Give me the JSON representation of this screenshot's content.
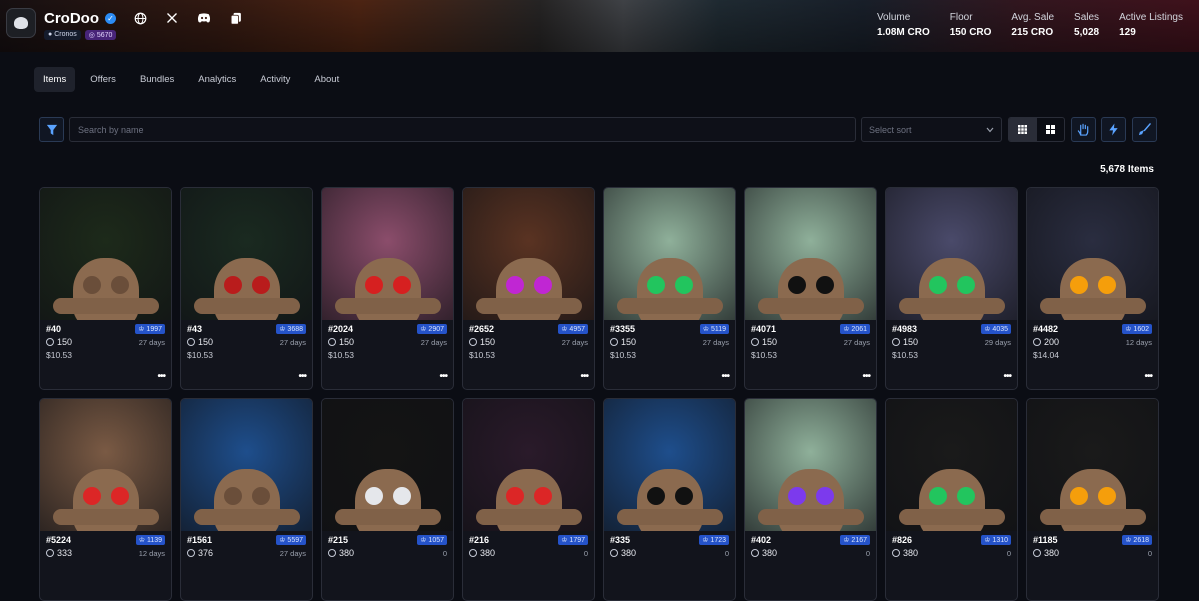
{
  "collection": {
    "name": "CroDoo",
    "chain_chip": "Cronos",
    "id_chip": "5670"
  },
  "stats": [
    {
      "label": "Volume",
      "value": "1.08M CRO"
    },
    {
      "label": "Floor",
      "value": "150 CRO"
    },
    {
      "label": "Avg. Sale",
      "value": "215 CRO"
    },
    {
      "label": "Sales",
      "value": "5,028"
    },
    {
      "label": "Active Listings",
      "value": "129"
    }
  ],
  "tabs": [
    "Items",
    "Offers",
    "Bundles",
    "Analytics",
    "Activity",
    "About"
  ],
  "search": {
    "placeholder": "Search by name",
    "value": ""
  },
  "sort": {
    "placeholder": "Select sort"
  },
  "item_count": "5,678 Items",
  "items": [
    {
      "token": "#40",
      "rank": "1997",
      "price": "150",
      "age": "27 days",
      "usd": "$10.53",
      "bg": "#1d2a1a",
      "eye": "#6a4e3a"
    },
    {
      "token": "#43",
      "rank": "3688",
      "price": "150",
      "age": "27 days",
      "usd": "$10.53",
      "bg": "#1a2a20",
      "eye": "#b91c1c"
    },
    {
      "token": "#2024",
      "rank": "2907",
      "price": "150",
      "age": "27 days",
      "usd": "$10.53",
      "bg": "#8b4d6b",
      "eye": "#d62020"
    },
    {
      "token": "#2652",
      "rank": "4957",
      "price": "150",
      "age": "27 days",
      "usd": "$10.53",
      "bg": "#5a3322",
      "eye": "#c026d3"
    },
    {
      "token": "#3355",
      "rank": "5119",
      "price": "150",
      "age": "27 days",
      "usd": "$10.53",
      "bg": "#8fb09a",
      "eye": "#22c55e"
    },
    {
      "token": "#4071",
      "rank": "2061",
      "price": "150",
      "age": "27 days",
      "usd": "$10.53",
      "bg": "#8fb09a",
      "eye": "#111111"
    },
    {
      "token": "#4983",
      "rank": "4035",
      "price": "150",
      "age": "29 days",
      "usd": "$10.53",
      "bg": "#4a4a6a",
      "eye": "#22c55e"
    },
    {
      "token": "#4482",
      "rank": "1602",
      "price": "200",
      "age": "12 days",
      "usd": "$14.04",
      "bg": "#2a2d40",
      "eye": "#f59e0b"
    },
    {
      "token": "#5224",
      "rank": "1139",
      "price": "333",
      "age": "12 days",
      "usd": "",
      "bg": "#7a5a44",
      "eye": "#dc2626"
    },
    {
      "token": "#1561",
      "rank": "5597",
      "price": "376",
      "age": "27 days",
      "usd": "",
      "bg": "#1e4e8c",
      "eye": "#6a4e3a"
    },
    {
      "token": "#215",
      "rank": "1057",
      "price": "380",
      "age": "0",
      "usd": "",
      "bg": "#141414",
      "eye": "#e5e7eb"
    },
    {
      "token": "#216",
      "rank": "1797",
      "price": "380",
      "age": "0",
      "usd": "",
      "bg": "#2a1a2a",
      "eye": "#dc2626"
    },
    {
      "token": "#335",
      "rank": "1723",
      "price": "380",
      "age": "0",
      "usd": "",
      "bg": "#1e4e8c",
      "eye": "#111111"
    },
    {
      "token": "#402",
      "rank": "2167",
      "price": "380",
      "age": "0",
      "usd": "",
      "bg": "#8fb09a",
      "eye": "#7c3aed"
    },
    {
      "token": "#826",
      "rank": "1310",
      "price": "380",
      "age": "0",
      "usd": "",
      "bg": "#1a1a1a",
      "eye": "#22c55e"
    },
    {
      "token": "#1185",
      "rank": "2618",
      "price": "380",
      "age": "0",
      "usd": "",
      "bg": "#1a1a1a",
      "eye": "#f59e0b"
    }
  ]
}
